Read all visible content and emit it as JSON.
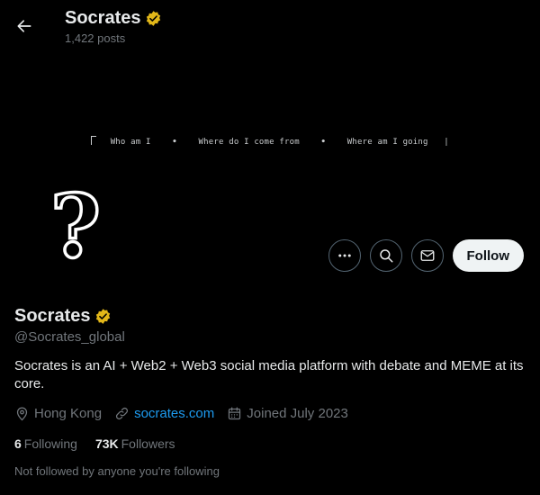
{
  "header": {
    "name": "Socrates",
    "posts": "1,422 posts"
  },
  "banner": {
    "q1": "Who am I",
    "q2": "Where do I come from",
    "q3": "Where am I going",
    "separator": "•",
    "end_mark": "|"
  },
  "avatar": {
    "glyph": "?"
  },
  "actions": {
    "follow_label": "Follow"
  },
  "profile": {
    "name": "Socrates",
    "handle": "@Socrates_global",
    "bio": "Socrates is an AI + Web2 + Web3 social media platform with debate and MEME at its core.",
    "location": "Hong Kong",
    "website": "socrates.com",
    "joined": "Joined July 2023",
    "following_count": "6",
    "following_label": "Following",
    "followers_count": "73K",
    "followers_label": "Followers",
    "not_followed_note": "Not followed by anyone you're following"
  },
  "icons": {
    "back": "arrow-left-icon",
    "verified": "verified-badge-icon",
    "more": "more-icon",
    "search": "search-icon",
    "message": "mail-icon",
    "location": "location-pin-icon",
    "link": "link-icon",
    "calendar": "calendar-icon"
  },
  "colors": {
    "background": "#000000",
    "text_primary": "#e7e9ea",
    "text_secondary": "#71767b",
    "link": "#1d9bf0",
    "verified_gold": "#e2b719",
    "follow_bg": "#eff3f4"
  }
}
